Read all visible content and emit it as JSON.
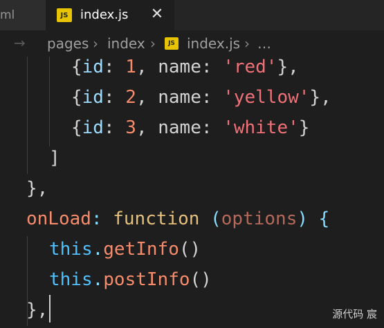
{
  "tabs": {
    "inactive_label": "ml",
    "active_label": "index.js",
    "close_glyph": "✕",
    "badge": "JS"
  },
  "breadcrumb": {
    "arrow": "→",
    "items": [
      "pages",
      "index",
      "index.js",
      "…"
    ],
    "separator": "›",
    "badge": "JS"
  },
  "code": {
    "lines": [
      {
        "k1": "id",
        "v1": "1",
        "k2": "name",
        "v2": "'red'"
      },
      {
        "k1": "id",
        "v1": "2",
        "k2": "name",
        "v2": "'yellow'"
      },
      {
        "k1": "id",
        "v1": "3",
        "k2": "name",
        "v2": "'white'"
      }
    ],
    "close_bracket": "]",
    "close_obj": "},",
    "onload_key": "onLoad",
    "function_kw": "function",
    "param": "options",
    "this_kw": "this",
    "call1": "getInfo",
    "call2": "postInfo",
    "final": "},"
  },
  "watermark": "源代码  宸",
  "colors": {
    "background": "#1e1e1e",
    "js_badge": "#e8c300",
    "key": "#9cdcfe",
    "number": "#f78c6c",
    "string": "#f07178",
    "keyword": "#e5c07b",
    "this": "#4fc1ff"
  }
}
